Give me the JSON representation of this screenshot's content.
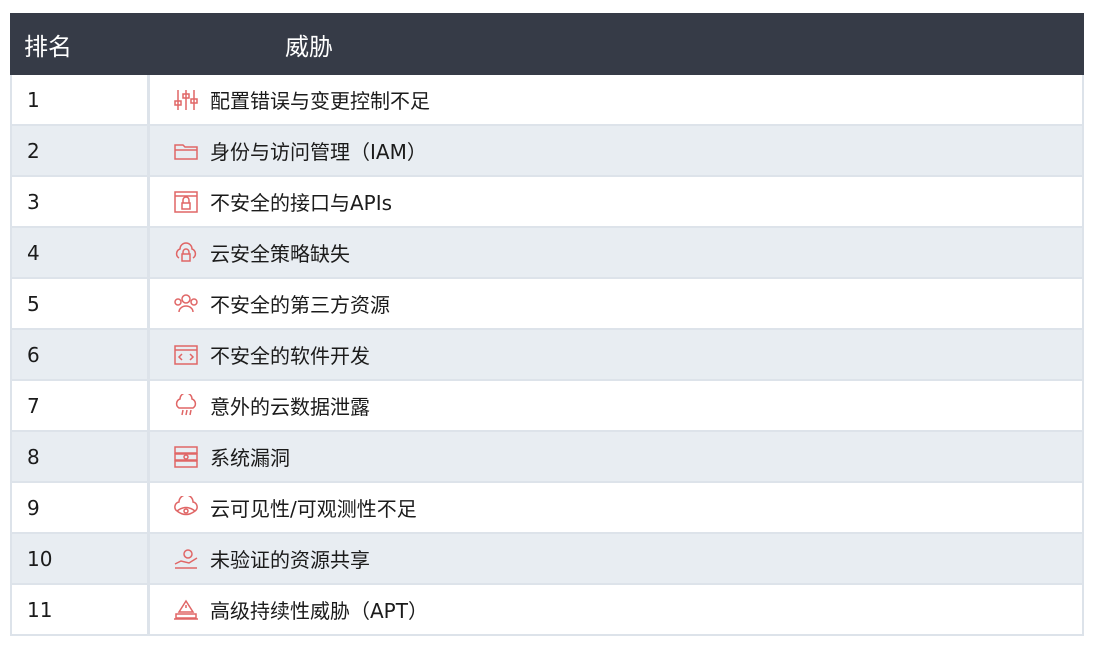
{
  "header": {
    "rank_label": "排名",
    "threat_label": "威胁"
  },
  "rows": [
    {
      "rank": "1",
      "threat": "配置错误与变更控制不足",
      "icon": "sliders-icon"
    },
    {
      "rank": "2",
      "threat": "身份与访问管理（IAM）",
      "icon": "folder-icon"
    },
    {
      "rank": "3",
      "threat": "不安全的接口与APIs",
      "icon": "browser-lock-icon"
    },
    {
      "rank": "4",
      "threat": "云安全策略缺失",
      "icon": "cloud-lock-icon"
    },
    {
      "rank": "5",
      "threat": "不安全的第三方资源",
      "icon": "users-icon"
    },
    {
      "rank": "6",
      "threat": "不安全的软件开发",
      "icon": "code-window-icon"
    },
    {
      "rank": "7",
      "threat": "意外的云数据泄露",
      "icon": "cloud-leak-icon"
    },
    {
      "rank": "8",
      "threat": "系统漏洞",
      "icon": "server-alert-icon"
    },
    {
      "rank": "9",
      "threat": "云可见性/可观测性不足",
      "icon": "cloud-eye-icon"
    },
    {
      "rank": "10",
      "threat": "未验证的资源共享",
      "icon": "hand-share-icon"
    },
    {
      "rank": "11",
      "threat": "高级持续性威胁（APT）",
      "icon": "warning-laptop-icon"
    }
  ],
  "colors": {
    "header_bg": "#363b47",
    "row_alt_bg": "#e8edf2",
    "icon_accent": "#e06666"
  }
}
